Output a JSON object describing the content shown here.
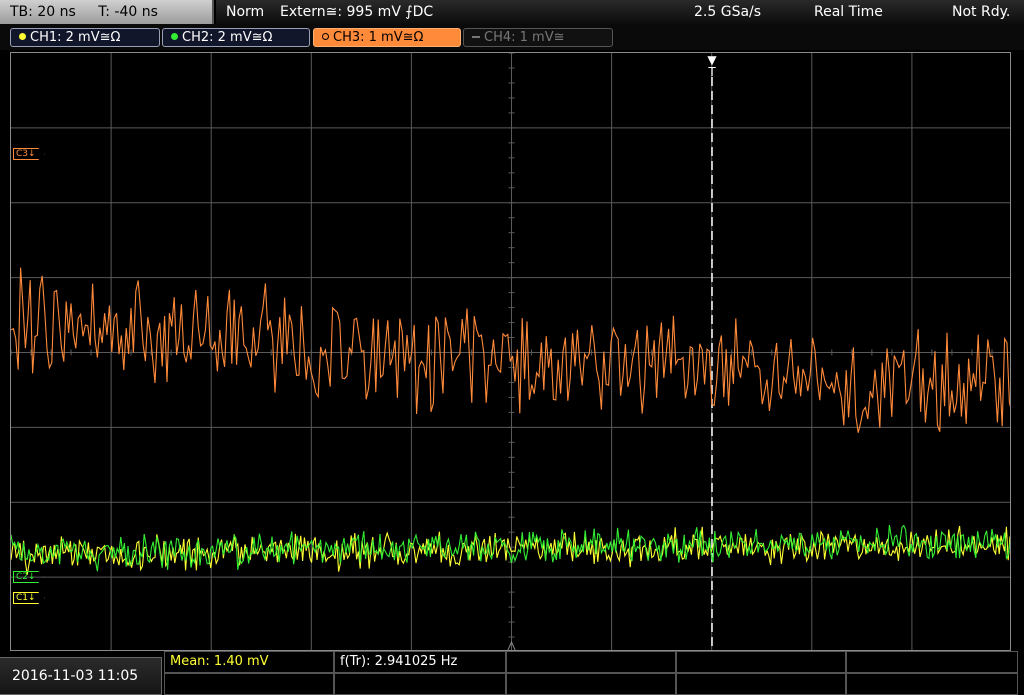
{
  "top": {
    "timebase": "TB: 20 ns",
    "trigger_time": "T: -40 ns",
    "mode": "Norm",
    "trigger_source": "Extern≅: 995 mV ⨍DC",
    "sample_rate": "2.5 GSa/s",
    "acq_mode": "Real Time",
    "status": "Not Rdy."
  },
  "channels": [
    {
      "label": "CH1: 2 mV≅Ω",
      "color": "#ffff33",
      "state": "on"
    },
    {
      "label": "CH2: 2 mV≅Ω",
      "color": "#33ee33",
      "state": "on"
    },
    {
      "label": "CH3: 1 mV≅Ω",
      "color": "#ff8a3a",
      "state": "active"
    },
    {
      "label": "CH4: 1 mV≅",
      "color": "#777777",
      "state": "off"
    }
  ],
  "markers": {
    "c3": "C3↓",
    "c2": "C2↓",
    "c1": "C1↓",
    "trigger": "T"
  },
  "bottom": {
    "datetime": "2016-11-03 11:05",
    "mean": "Mean: 1.40 mV",
    "freq": "f(Tr): 2.941025 Hz"
  },
  "colors": {
    "grid": "#5a5a5a",
    "ch1": "#ffff33",
    "ch2": "#33ee33",
    "ch3": "#ff8a3a",
    "mean_text": "#ffff33"
  }
}
